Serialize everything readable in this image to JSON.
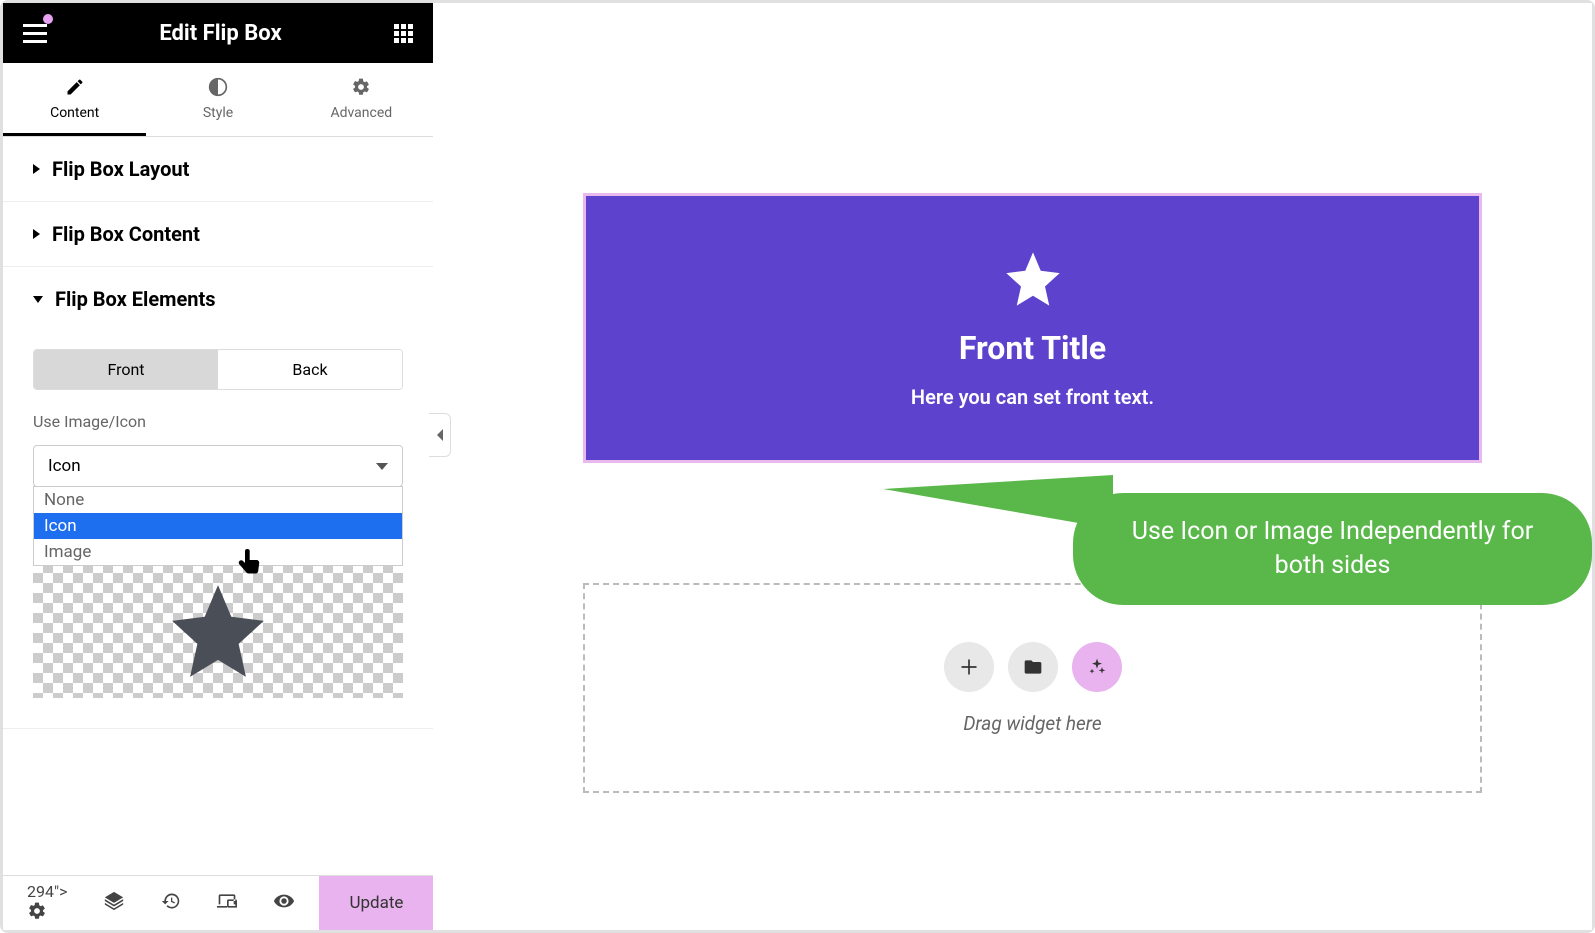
{
  "header": {
    "title": "Edit Flip Box"
  },
  "tabs": {
    "content": "Content",
    "style": "Style",
    "advanced": "Advanced"
  },
  "sections": {
    "layout": "Flip Box Layout",
    "content": "Flip Box Content",
    "elements": "Flip Box Elements"
  },
  "elements": {
    "front_tab": "Front",
    "back_tab": "Back",
    "use_image_icon_label": "Use Image/Icon",
    "select_value": "Icon",
    "options": {
      "none": "None",
      "icon": "Icon",
      "image": "Image"
    }
  },
  "preview": {
    "title": "Front Title",
    "text": "Here you can set front text."
  },
  "callout": "Use Icon or Image Independently for both sides",
  "drop_zone": {
    "text": "Drag widget here"
  },
  "footer": {
    "update": "Update"
  }
}
